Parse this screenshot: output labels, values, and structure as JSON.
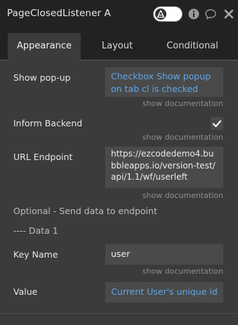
{
  "window": {
    "title": "PageClosedListener A"
  },
  "tabs": [
    {
      "label": "Appearance",
      "active": true
    },
    {
      "label": "Layout",
      "active": false
    },
    {
      "label": "Conditional",
      "active": false
    }
  ],
  "fields": {
    "show_popup": {
      "label": "Show pop-up",
      "value": "Checkbox Show popup on tab cl is checked",
      "doc": "show documentation"
    },
    "inform_backend": {
      "label": "Inform Backend",
      "checked": true,
      "doc": "show documentation"
    },
    "url_endpoint": {
      "label": "URL Endpoint",
      "value": "https://ezcodedemo4.bubbleapps.io/version-test/api/1.1/wf/userleft",
      "doc": "show documentation"
    },
    "optional_heading": "Optional - Send data to endpoint",
    "data_heading": "---- Data 1",
    "key_name": {
      "label": "Key Name",
      "value": "user",
      "doc": "show documentation"
    },
    "value": {
      "label": "Value",
      "value": "Current User's unique id"
    }
  },
  "colors": {
    "dynamic_text": "#5ea7e8",
    "panel_bg": "#3b3b3b",
    "header_bg": "#222222"
  }
}
